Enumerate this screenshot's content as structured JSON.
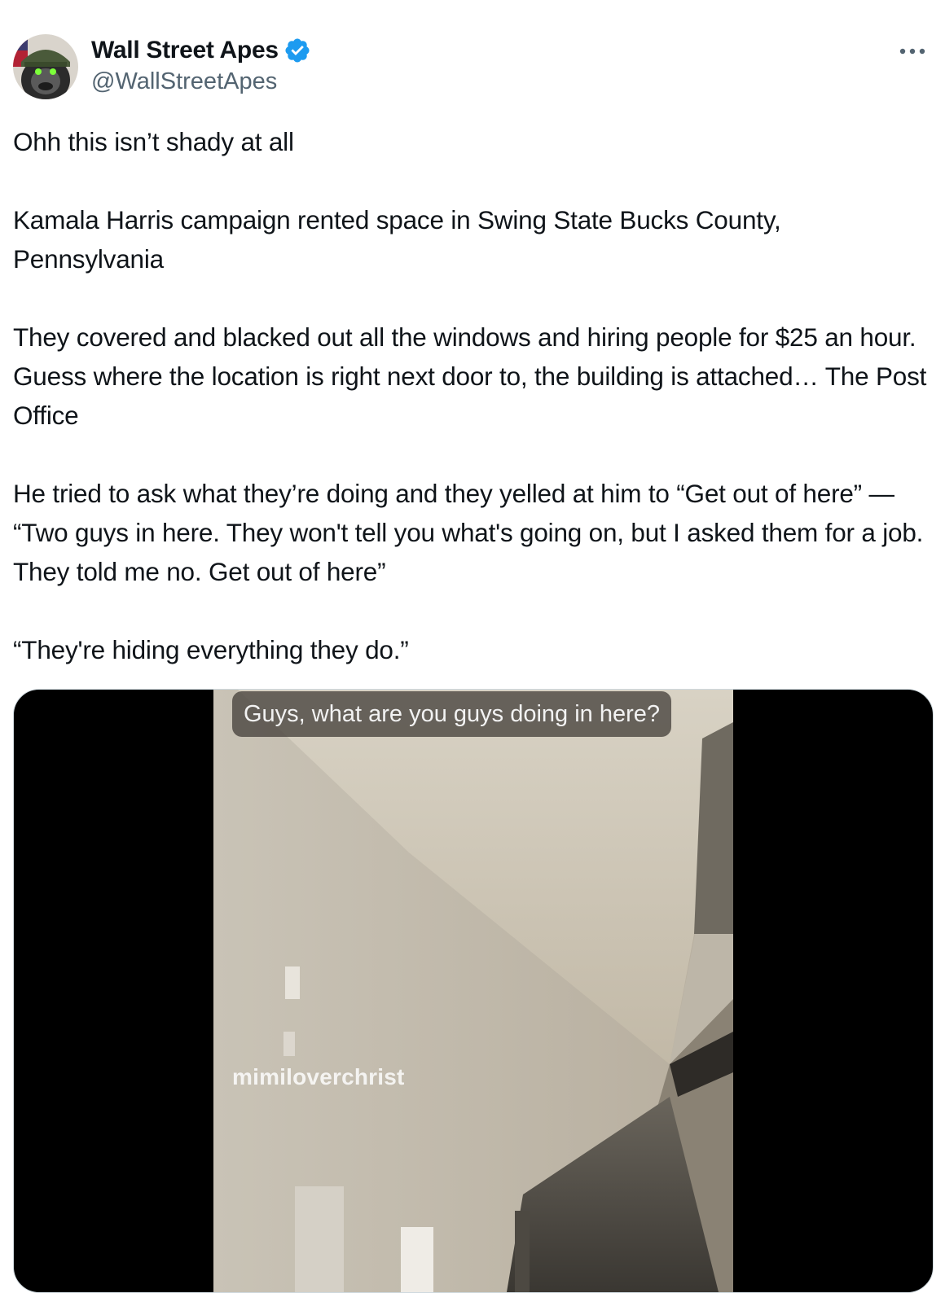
{
  "author": {
    "display_name": "Wall Street Apes",
    "handle": "@WallStreetApes",
    "verified": true,
    "avatar_icon": "gorilla-helmet-avatar-icon"
  },
  "tweet": {
    "paragraphs": [
      "Ohh this isn’t shady at all",
      "Kamala Harris campaign rented space in Swing State Bucks County, Pennsylvania",
      "They covered and blacked out all the windows and hiring people for $25 an hour. Guess where the location is right next door to, the building is attached… The Post Office",
      "He tried to ask what they’re doing and they yelled at him to “Get out of here” — “Two guys in here. They won't tell you what's going on, but I asked them for a job. They told me no. Get out of here”",
      "“They're hiding everything they do.”"
    ]
  },
  "media": {
    "caption": "Guys, what are you guys doing in here?",
    "watermark": "mimiloverchrist"
  },
  "colors": {
    "verified_blue": "#1d9bf0",
    "handle_gray": "#536471",
    "text": "#0f1419"
  },
  "icons": {
    "more": "more-options-icon",
    "verified": "verified-badge-icon"
  }
}
